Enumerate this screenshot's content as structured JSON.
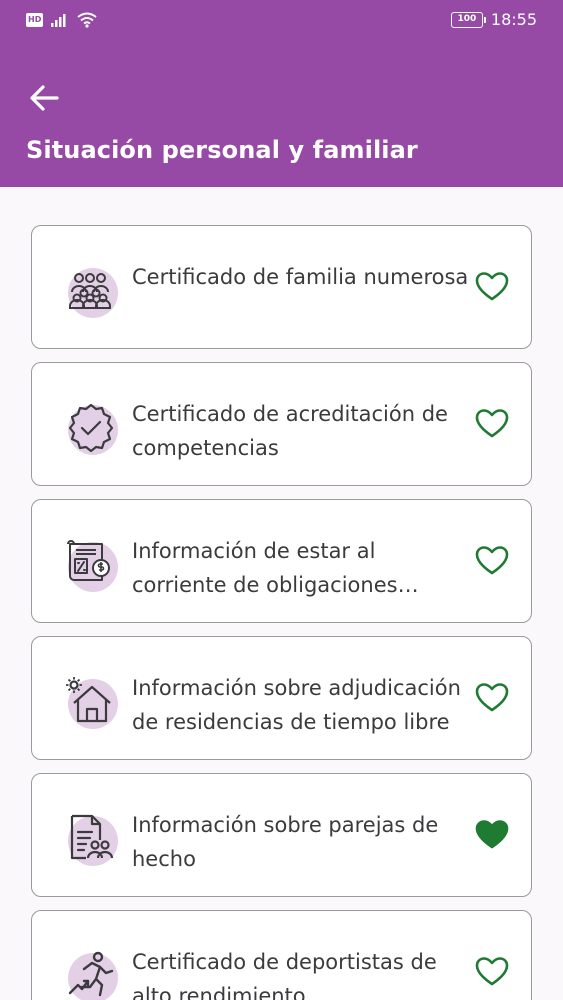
{
  "status": {
    "hd_label": "HD",
    "battery": "100",
    "time": "18:55",
    "icons": [
      "signal-icon",
      "wifi-icon",
      "battery-icon"
    ]
  },
  "header": {
    "back_icon": "arrow-left-icon",
    "title": "Situación personal y familiar"
  },
  "colors": {
    "primary": "#964aa6",
    "icon_bg": "#e3d0e6",
    "favorite": "#1f7a32",
    "text": "#3b3b3e"
  },
  "items": [
    {
      "label": "Certificado de familia numerosa",
      "icon": "family-group-icon",
      "favorite": false
    },
    {
      "label": "Certificado de acreditación de competencias",
      "icon": "verified-badge-icon",
      "favorite": false
    },
    {
      "label": "Información de estar al corriente de obligaciones tributarias",
      "icon": "tax-document-icon",
      "favorite": false
    },
    {
      "label": "Información sobre adjudicación de residencias de tiempo libre",
      "icon": "holiday-house-icon",
      "favorite": false
    },
    {
      "label": "Información sobre parejas de hecho",
      "icon": "couple-document-icon",
      "favorite": true
    },
    {
      "label": "Certificado de deportistas de alto rendimiento",
      "icon": "athlete-icon",
      "favorite": false
    }
  ]
}
